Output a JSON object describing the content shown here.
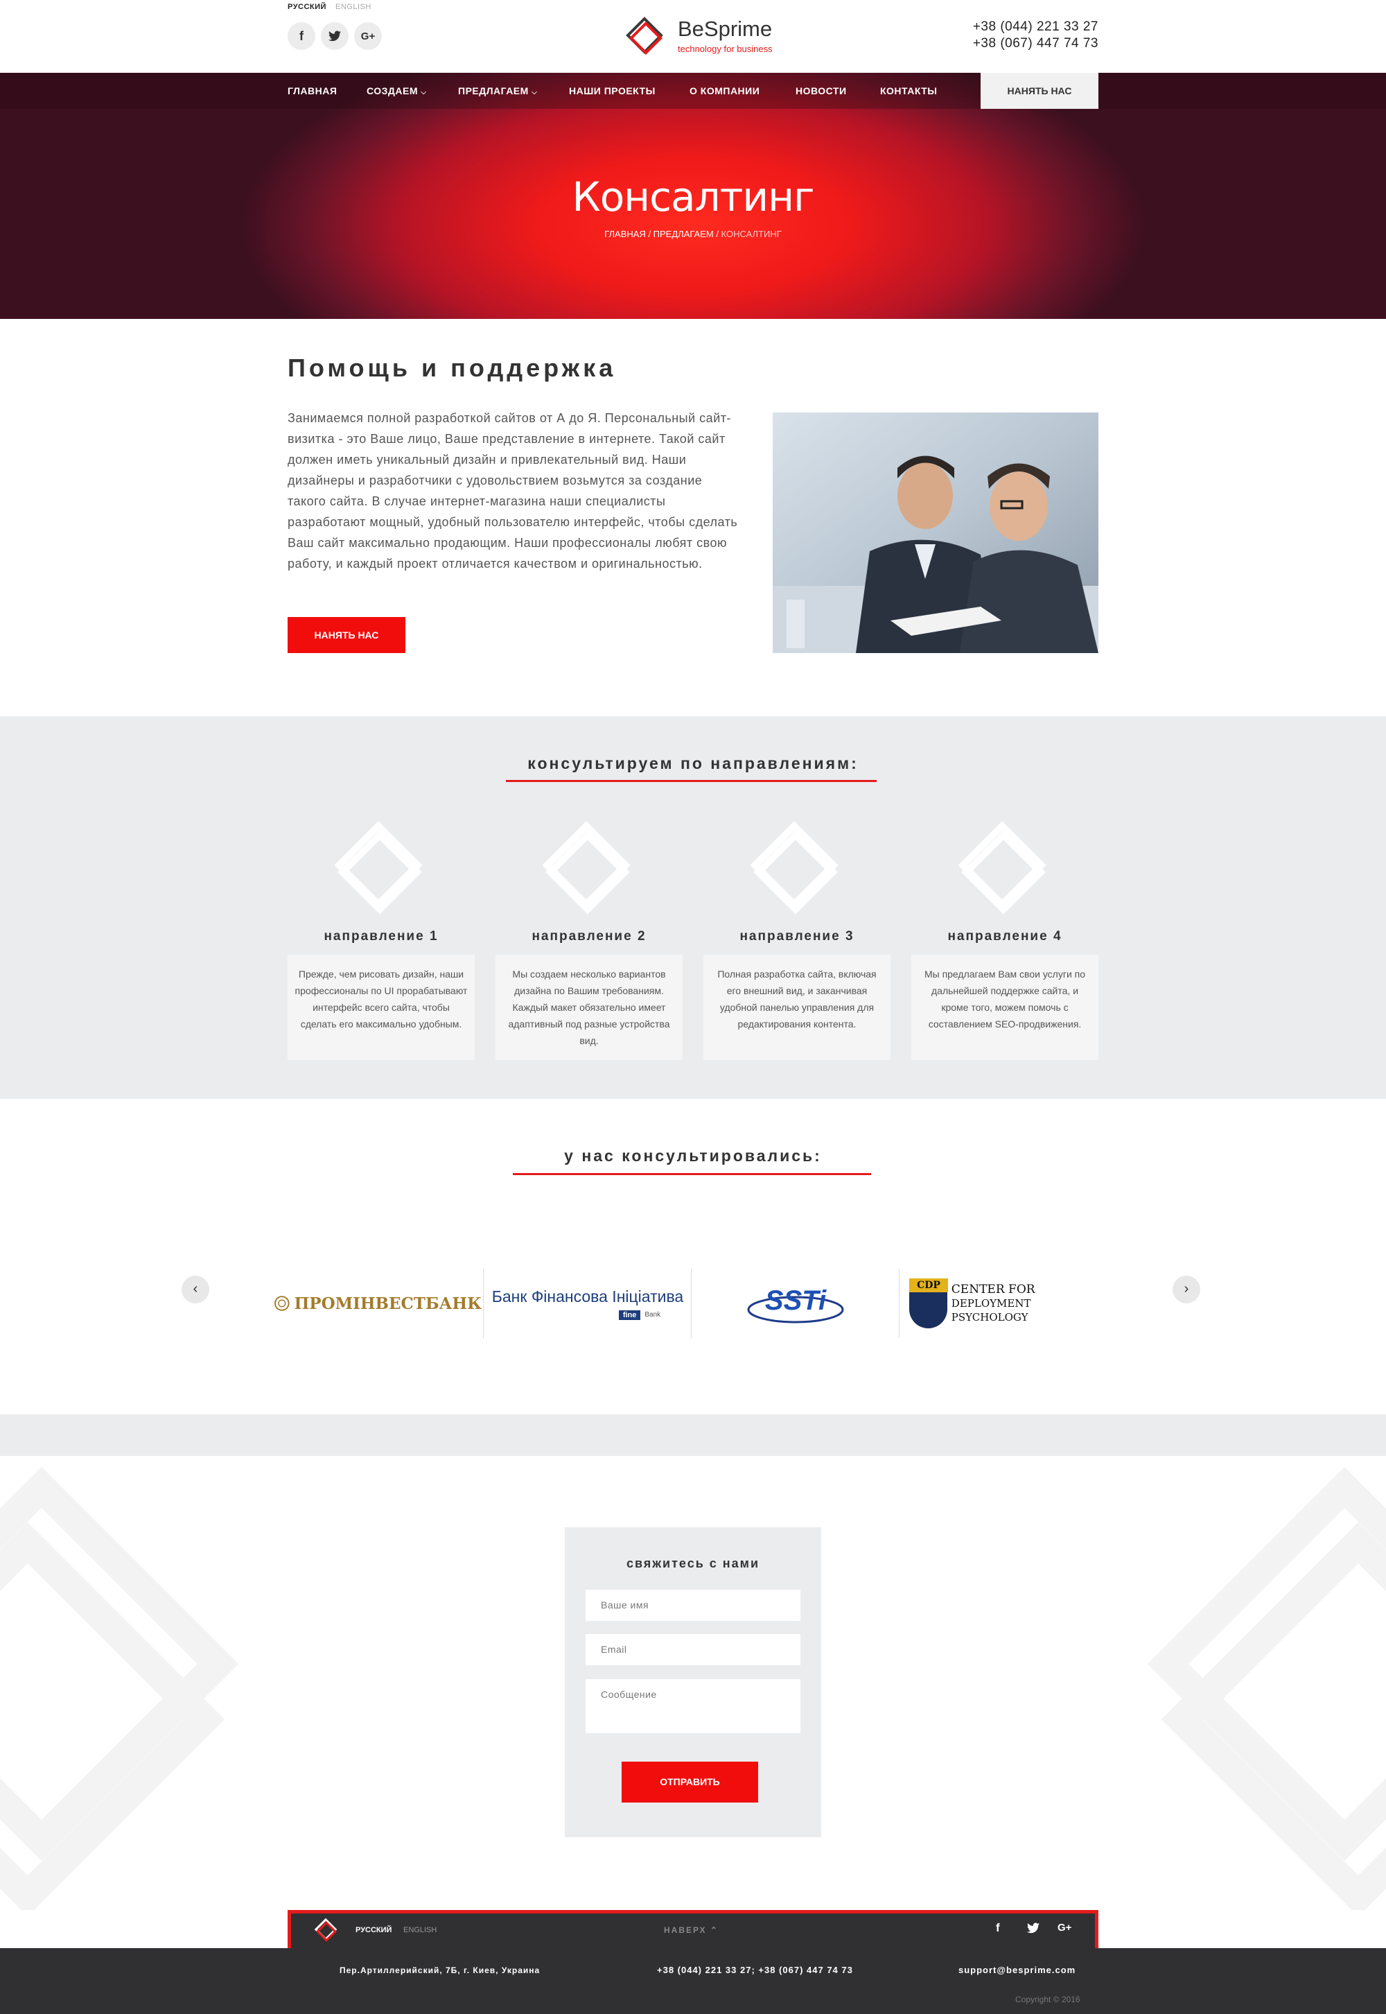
{
  "header": {
    "lang_active": "РУССКИЙ",
    "lang_other": "ENGLISH",
    "social": [
      "f",
      "t",
      "G+"
    ],
    "logo_name": "BeSprime",
    "logo_tagline": "technology for business",
    "phone1": "+38 (044) 221 33 27",
    "phone2": "+38 (067) 447 74 73"
  },
  "nav": {
    "items": [
      "ГЛАВНАЯ",
      "СОЗДАЕМ",
      "ПРЕДЛАГАЕМ",
      "НАШИ ПРОЕКТЫ",
      "О КОМПАНИИ",
      "НОВОСТИ",
      "КОНТАКТЫ"
    ],
    "hire": "НАНЯТЬ НАС"
  },
  "hero": {
    "title": "Консалтинг",
    "crumb1": "ГЛАВНАЯ / ПРЕДЛАГАЕМ / ",
    "crumb2": "КОНСАЛТИНГ"
  },
  "about": {
    "title": "Помощь и поддержка",
    "text": "Занимаемся полной разработкой сайтов от А до Я. Персональный сайт-визитка - это Ваше лицо, Ваше представление в интернете. Такой сайт должен иметь уникальный дизайн и привлекательный вид. Наши дизайнеры и разработчики с удовольствием возьмутся за создание такого сайта. В случае интернет-магазина наши специалисты разработают мощный, удобный пользователю интерфейс, чтобы сделать Ваш сайт максимально продающим. Наши профессионалы любят свою работу, и каждый проект отличается качеством и оригинальностью.",
    "button": "НАНЯТЬ НАС"
  },
  "directions": {
    "title": "консультируем по направлениям:",
    "items": [
      {
        "title": "направление 1",
        "text": "Прежде, чем рисовать дизайн, наши профессионалы по UI прорабатывают интерфейс всего сайта, чтобы сделать его максимально удобным."
      },
      {
        "title": "направление 2",
        "text": "Мы создаем несколько вариантов дизайна по Вашим требованиям. Каждый макет обязательно имеет адаптивный под разные устройства вид."
      },
      {
        "title": "направление 3",
        "text": "Полная разработка сайта, включая его внешний вид, и заканчивая удобной панелью управления для редактирования контента."
      },
      {
        "title": "направление 4",
        "text": "Мы предлагаем Вам свои услуги по дальнейшей поддержке сайта, и кроме того, можем помочь с составлением SEO-продвижения."
      }
    ]
  },
  "partners": {
    "title": "у нас консультировались:",
    "logos": [
      {
        "text": "ПРОМІНВЕСТБАНК"
      },
      {
        "text": "Банк Фінансова Ініціатива",
        "sub": "Bank",
        "mark": "fine"
      },
      {
        "text": "SSTi"
      },
      {
        "text1": "CENTER FOR",
        "text2": "DEPLOYMENT PSYCHOLOGY",
        "mark": "CDP"
      }
    ],
    "prev": "‹",
    "next": "›"
  },
  "contact": {
    "title": "свяжитесь с нами",
    "name_placeholder": "Ваше имя",
    "email_placeholder": "Email",
    "message_placeholder": "Сообщение",
    "submit": "ОТПРАВИТЬ"
  },
  "footer": {
    "lang_active": "РУССКИЙ",
    "lang_other": "ENGLISH",
    "top": "НАВЕРХ",
    "address": "Пер.Артиллерийский, 7Б, г. Киев, Украина",
    "phones": "+38 (044) 221 33 27; +38 (067) 447 74 73",
    "email": "support@besprime.com",
    "copyright": "Copyright © 2016"
  },
  "colors": {
    "accent": "#f20d0d",
    "nav_bg": "#4d1220",
    "gray_bg": "#ebecee",
    "footer_bg": "#303032"
  }
}
